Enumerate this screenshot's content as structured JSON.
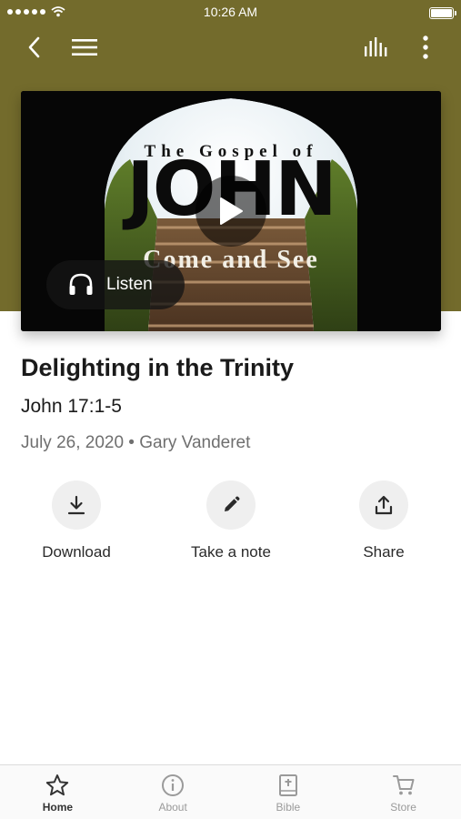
{
  "status_bar": {
    "time": "10:26 AM"
  },
  "nav": {
    "back_icon": "chevron-left-icon",
    "menu_icon": "hamburger-menu-icon",
    "audio_icon": "equalizer-bars-icon",
    "more_icon": "more-vertical-icon"
  },
  "hero": {
    "title_small": "The Gospel of",
    "title_big": "JOHN",
    "subtitle": "Come and See",
    "play_icon": "play-icon",
    "listen_label": "Listen",
    "listen_icon": "headphones-icon"
  },
  "sermon": {
    "title": "Delighting in the Trinity",
    "passage": "John 17:1-5",
    "meta": "July 26, 2020 • Gary Vanderet"
  },
  "actions": [
    {
      "label": "Download",
      "icon": "download-icon"
    },
    {
      "label": "Take a note",
      "icon": "pencil-icon"
    },
    {
      "label": "Share",
      "icon": "share-icon"
    }
  ],
  "tabs": [
    {
      "label": "Home",
      "icon": "star-icon",
      "active": true
    },
    {
      "label": "About",
      "icon": "info-icon",
      "active": false
    },
    {
      "label": "Bible",
      "icon": "bible-icon",
      "active": false
    },
    {
      "label": "Store",
      "icon": "cart-icon",
      "active": false
    }
  ],
  "colors": {
    "header_bg": "#736b2c",
    "action_circle_bg": "#efefef",
    "tab_active": "#333333",
    "tab_inactive": "#9a9a9a"
  }
}
